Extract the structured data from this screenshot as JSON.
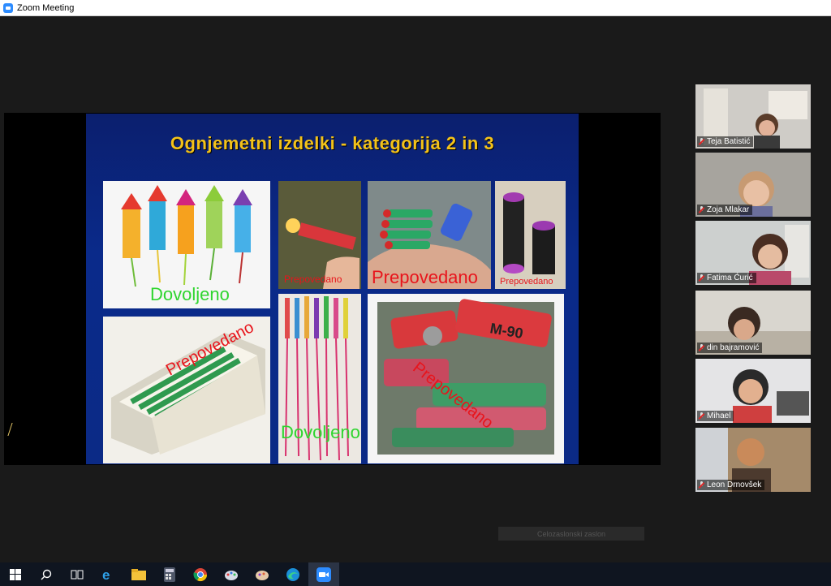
{
  "window": {
    "title": "Zoom Meeting",
    "app_icon": "zoom-icon"
  },
  "slide": {
    "title": "Ognjemetni izdelki  - kategorija 2 in 3",
    "tiles": [
      {
        "label": "Dovoljeno",
        "status": "allowed"
      },
      {
        "label": "Prepovedano",
        "status": "forbidden"
      },
      {
        "label": "Prepovedano",
        "status": "forbidden"
      },
      {
        "label": "Prepovedano",
        "status": "forbidden"
      },
      {
        "label": "Prepovedano",
        "status": "forbidden"
      },
      {
        "label": "Dovoljeno",
        "status": "allowed"
      },
      {
        "label": "Prepovedano",
        "status": "forbidden"
      }
    ],
    "tile_image_text": "M-90"
  },
  "participants": [
    {
      "name": "Teja Batistić",
      "muted": true
    },
    {
      "name": "Zoja Mlakar",
      "muted": true
    },
    {
      "name": "Fatima Ćurić",
      "muted": true
    },
    {
      "name": "din bajramović",
      "muted": true
    },
    {
      "name": "Mihael",
      "muted": true
    },
    {
      "name": "Leon Drnovšek",
      "muted": true
    }
  ],
  "caption": {
    "text": "Celozaslonski zaslon"
  },
  "taskbar": {
    "items": [
      "windows-start-icon",
      "search-icon",
      "task-view-icon",
      "internet-explorer-icon",
      "file-explorer-icon",
      "calculator-icon",
      "chrome-icon",
      "paint-icon",
      "paint-3d-icon",
      "edge-icon",
      "zoom-icon"
    ],
    "active": "zoom-icon"
  },
  "colors": {
    "slide_bg": "#0a2a8a",
    "title": "#f3c21a",
    "allowed": "#2fd52f",
    "forbidden": "#e8141b",
    "zoom": "#2d8cff"
  }
}
